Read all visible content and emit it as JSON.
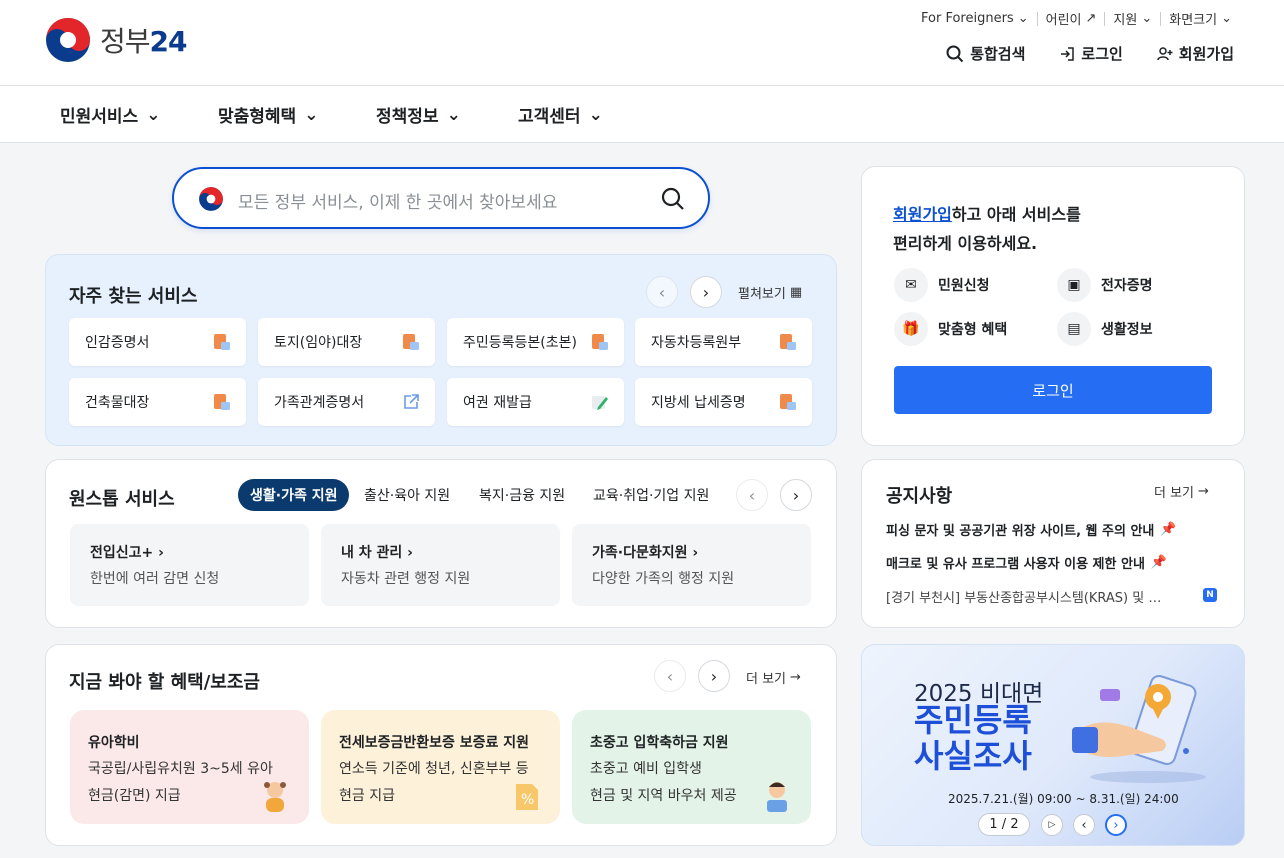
{
  "header": {
    "logo_text": "정부",
    "logo_num": "24",
    "utility": [
      "For Foreigners",
      "어린이",
      "지원",
      "화면크기"
    ],
    "actions": {
      "search": "통합검색",
      "login": "로그인",
      "signup": "회원가입"
    }
  },
  "gnb": [
    "민원서비스",
    "맞춤형혜택",
    "정책정보",
    "고객센터"
  ],
  "search": {
    "placeholder": "모든 정부 서비스, 이제 한 곳에서 찾아보세요"
  },
  "frequent": {
    "title": "자주 찾는 서비스",
    "expand": "펼쳐보기",
    "items": [
      "인감증명서",
      "토지(임야)대장",
      "주민등록등본(초본)",
      "자동차등록원부",
      "건축물대장",
      "가족관계증명서",
      "여권 재발급",
      "지방세 납세증명"
    ]
  },
  "onestop": {
    "title": "원스톱 서비스",
    "tabs": [
      "생활·가족 지원",
      "출산·육아 지원",
      "복지·금융 지원",
      "교육·취업·기업 지원"
    ],
    "items": [
      {
        "title": "전입신고+",
        "desc": "한번에 여러 감면 신청"
      },
      {
        "title": "내 차 관리",
        "desc": "자동차 관련 행정 지원"
      },
      {
        "title": "가족·다문화지원",
        "desc": "다양한 가족의 행정 지원"
      }
    ]
  },
  "benefits": {
    "title": "지금 봐야 할 혜택/보조금",
    "more": "더 보기",
    "items": [
      {
        "title": "유아학비",
        "line1": "국공립/사립유치원 3~5세 유아",
        "line2": "현금(감면) 지급",
        "bg": "#fbe9e9"
      },
      {
        "title": "전세보증금반환보증 보증료 지원",
        "line1": "연소득 기준에 청년, 신혼부부 등",
        "line2": "현금 지급",
        "bg": "#fdf1da"
      },
      {
        "title": "초중고 입학축하금 지원",
        "line1": "초중고 예비 입학생",
        "line2": "현금 및 지역 바우처 제공",
        "bg": "#e3f3e8"
      }
    ]
  },
  "login_card": {
    "highlight": "회원가입",
    "line1_rest": "하고 아래 서비스를",
    "line2": "편리하게 이용하세요.",
    "services": [
      "민원신청",
      "전자증명",
      "맞춤형 혜택",
      "생활정보"
    ],
    "button": "로그인"
  },
  "notice": {
    "title": "공지사항",
    "more": "더 보기",
    "items": [
      "피싱 문자 및 공공기관 위장 사이트, 웹 주의 안내",
      "매크로 및 유사 프로그램 사용자 이용 제한 안내",
      "[경기 부천시] 부동산종합공부시스템(KRAS) 및 …"
    ],
    "new_badge": "N"
  },
  "banner": {
    "line1": "2025 비대면",
    "line2": "주민등록",
    "line3": "사실조사",
    "date": "2025.7.21.(월) 09:00 ~ 8.31.(일) 24:00",
    "pager": "1 / 2"
  }
}
